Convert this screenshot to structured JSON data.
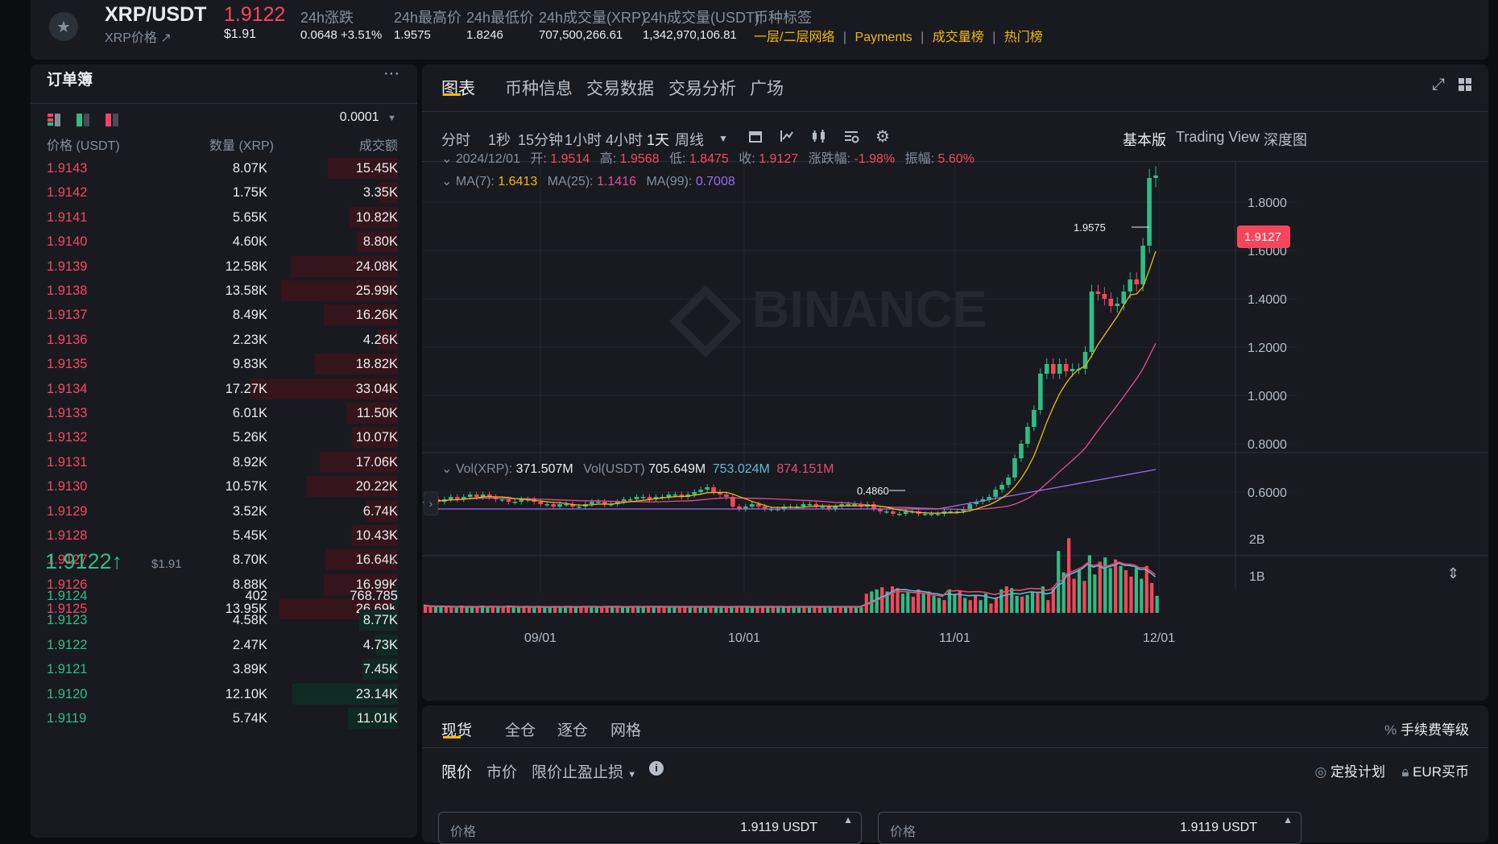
{
  "ticker": {
    "pair": "XRP/USDT",
    "price": "1.9122",
    "price_usd": "$1.91",
    "sub_link": "XRP价格 ↗",
    "stats": [
      {
        "label": "24h涨跌",
        "value": "0.0648 +3.51%",
        "color": "up"
      },
      {
        "label": "24h最高价",
        "value": "1.9575"
      },
      {
        "label": "24h最低价",
        "value": "1.8246"
      },
      {
        "label": "24h成交量(XRP)",
        "value": "707,500,266.61"
      },
      {
        "label": "24h成交量(USDT)",
        "value": "1,342,970,106.81"
      }
    ],
    "tags_label": "币种标签",
    "tags": [
      "一层/二层网络",
      "Payments",
      "成交量榜",
      "热门榜"
    ]
  },
  "orderbook": {
    "title": "订单簿",
    "more": "···",
    "precision": "0.0001",
    "headers": [
      "价格 (USDT)",
      "数量 (XRP)",
      "成交额"
    ],
    "asks": [
      [
        "1.9143",
        "8.07K",
        "15.45K",
        0.38
      ],
      [
        "1.9142",
        "1.75K",
        "3.35K",
        0.1
      ],
      [
        "1.9141",
        "5.65K",
        "10.82K",
        0.26
      ],
      [
        "1.9140",
        "4.60K",
        "8.80K",
        0.22
      ],
      [
        "1.9139",
        "12.58K",
        "24.08K",
        0.58
      ],
      [
        "1.9138",
        "13.58K",
        "25.99K",
        0.63
      ],
      [
        "1.9137",
        "8.49K",
        "16.26K",
        0.4
      ],
      [
        "1.9136",
        "2.23K",
        "4.26K",
        0.11
      ],
      [
        "1.9135",
        "9.83K",
        "18.82K",
        0.45
      ],
      [
        "1.9134",
        "17.27K",
        "33.04K",
        0.8
      ],
      [
        "1.9133",
        "6.01K",
        "11.50K",
        0.28
      ],
      [
        "1.9132",
        "5.26K",
        "10.07K",
        0.25
      ],
      [
        "1.9131",
        "8.92K",
        "17.06K",
        0.42
      ],
      [
        "1.9130",
        "10.57K",
        "20.22K",
        0.49
      ],
      [
        "1.9129",
        "3.52K",
        "6.74K",
        0.17
      ],
      [
        "1.9128",
        "5.45K",
        "10.43K",
        0.25
      ],
      [
        "1.9127",
        "8.70K",
        "16.64K",
        0.39
      ],
      [
        "1.9126",
        "8.88K",
        "16.99K",
        0.4
      ],
      [
        "1.9125",
        "13.95K",
        "26.69K",
        0.64
      ]
    ],
    "last_price": "1.9122",
    "last_arrow": "↑",
    "last_usd": "$1.91",
    "bids": [
      [
        "1.9124",
        "402",
        "768.785",
        0.02
      ],
      [
        "1.9123",
        "4.58K",
        "8.77K",
        0.21
      ],
      [
        "1.9122",
        "2.47K",
        "4.73K",
        0.12
      ],
      [
        "1.9121",
        "3.89K",
        "7.45K",
        0.19
      ],
      [
        "1.9120",
        "12.10K",
        "23.14K",
        0.57
      ],
      [
        "1.9119",
        "5.74K",
        "11.01K",
        0.27
      ]
    ]
  },
  "chart_tabs": [
    "图表",
    "币种信息",
    "交易数据",
    "交易分析",
    "广场"
  ],
  "intervals": [
    "分时",
    "1秒",
    "15分钟",
    "1小时",
    "4小时",
    "1天",
    "周线"
  ],
  "active_interval": "1天",
  "views": [
    "基本版",
    "Trading View",
    "深度图"
  ],
  "ohlc": {
    "date": "2024/12/01",
    "open_label": "开:",
    "open": "1.9514",
    "high_label": "高:",
    "high": "1.9568",
    "low_label": "低:",
    "low": "1.8475",
    "close_label": "收:",
    "close": "1.9127",
    "chg_label": "涨跌幅:",
    "chg": "-1.98%",
    "amp_label": "振幅:",
    "amp": "5.60%"
  },
  "ma": {
    "ma7_label": "MA(7):",
    "ma7": "1.6413",
    "ma25_label": "MA(25):",
    "ma25": "1.1416",
    "ma99_label": "MA(99):",
    "ma99": "0.7008"
  },
  "vol": {
    "xrp_label": "Vol(XRP):",
    "xrp": "371.507M",
    "usdt_label": "Vol(USDT)",
    "usdt": "705.649M",
    "ma1": "753.024M",
    "ma2": "874.151M"
  },
  "watermark": "BINANCE",
  "colors": {
    "up": "#2ebd85",
    "down": "#f6465d",
    "accent": "#f0b90b",
    "ma7": "#f0b90b",
    "ma25": "#e34d9a",
    "ma99": "#9b6cf0"
  },
  "chart_data": {
    "type": "candlestick",
    "price_axis": [
      "1.8000",
      "1.6000",
      "1.4000",
      "1.2000",
      "1.0000",
      "0.8000",
      "0.6000"
    ],
    "price_range": [
      0.4,
      2.0
    ],
    "vol_axis": [
      "2B",
      "1B"
    ],
    "x_labels": [
      "09/01",
      "10/01",
      "11/01",
      "12/01"
    ],
    "current_price_tag": "1.9127",
    "high_marker": "1.9575",
    "low_marker": "0.4860",
    "close_series": [
      0.56,
      0.57,
      0.56,
      0.57,
      0.58,
      0.57,
      0.58,
      0.59,
      0.58,
      0.59,
      0.58,
      0.57,
      0.57,
      0.56,
      0.56,
      0.57,
      0.57,
      0.56,
      0.55,
      0.55,
      0.54,
      0.55,
      0.55,
      0.54,
      0.54,
      0.55,
      0.56,
      0.56,
      0.55,
      0.55,
      0.56,
      0.57,
      0.57,
      0.58,
      0.58,
      0.57,
      0.58,
      0.58,
      0.59,
      0.59,
      0.58,
      0.59,
      0.6,
      0.61,
      0.62,
      0.6,
      0.59,
      0.58,
      0.54,
      0.53,
      0.54,
      0.55,
      0.54,
      0.53,
      0.53,
      0.53,
      0.54,
      0.54,
      0.54,
      0.55,
      0.55,
      0.54,
      0.54,
      0.53,
      0.54,
      0.55,
      0.55,
      0.55,
      0.54,
      0.55,
      0.53,
      0.52,
      0.52,
      0.51,
      0.51,
      0.52,
      0.52,
      0.51,
      0.51,
      0.51,
      0.51,
      0.52,
      0.52,
      0.52,
      0.53,
      0.55,
      0.56,
      0.57,
      0.58,
      0.61,
      0.63,
      0.66,
      0.74,
      0.8,
      0.87,
      0.94,
      1.09,
      1.13,
      1.09,
      1.13,
      1.1,
      1.11,
      1.11,
      1.18,
      1.43,
      1.42,
      1.4,
      1.37,
      1.38,
      1.43,
      1.48,
      1.46,
      1.62,
      1.9,
      1.91
    ],
    "volume_series": [
      0.18,
      0.15,
      0.14,
      0.16,
      0.14,
      0.15,
      0.12,
      0.17,
      0.14,
      0.15,
      0.13,
      0.17,
      0.14,
      0.15,
      0.16,
      0.12,
      0.17,
      0.15,
      0.13,
      0.14,
      0.16,
      0.13,
      0.15,
      0.14,
      0.13,
      0.15,
      0.14,
      0.16,
      0.15,
      0.13,
      0.14,
      0.16,
      0.15,
      0.14,
      0.13,
      0.16,
      0.15,
      0.14,
      0.15,
      0.13,
      0.16,
      0.14,
      0.15,
      0.16,
      0.15,
      0.14,
      0.13,
      0.15,
      0.14,
      0.15,
      0.16,
      0.14,
      0.15,
      0.13,
      0.14,
      0.15,
      0.16,
      0.14,
      0.13,
      0.15,
      0.14,
      0.16,
      0.15,
      0.14,
      0.13,
      0.14,
      0.15,
      0.16,
      0.14,
      0.15,
      0.13,
      0.14,
      0.15,
      0.14,
      0.16,
      0.15,
      0.14,
      0.13,
      0.15,
      0.14,
      0.15,
      0.16,
      0.14,
      0.15,
      0.13,
      0.45,
      0.5,
      0.55,
      0.6,
      0.5,
      0.62,
      0.58,
      0.45,
      0.5,
      0.38,
      0.55,
      0.44,
      0.5,
      0.4,
      0.35,
      0.3,
      0.55,
      0.45,
      0.52,
      0.35,
      0.3,
      0.4,
      0.3,
      0.45,
      0.22,
      0.35,
      0.55,
      0.62,
      0.58,
      0.4,
      0.38,
      0.42,
      0.5,
      0.48,
      0.62,
      0.3,
      0.6,
      1.45,
      0.95,
      1.75,
      0.8,
      1.0,
      0.75,
      1.35,
      0.9,
      1.2,
      1.3,
      1.05,
      1.25,
      1.1,
      1.0,
      0.85,
      1.05,
      0.8,
      1.1,
      0.7,
      0.4
    ]
  },
  "trade": {
    "tabs": [
      "现货",
      "全仓",
      "逐仓",
      "网格"
    ],
    "fee_label": "手续费等级",
    "order_types": [
      "限价",
      "市价",
      "限价止盈止损"
    ],
    "plan_label": "定投计划",
    "eur_label": "EUR买币",
    "price_placeholder": "价格",
    "price_value": "1.9119",
    "unit": "USDT"
  }
}
